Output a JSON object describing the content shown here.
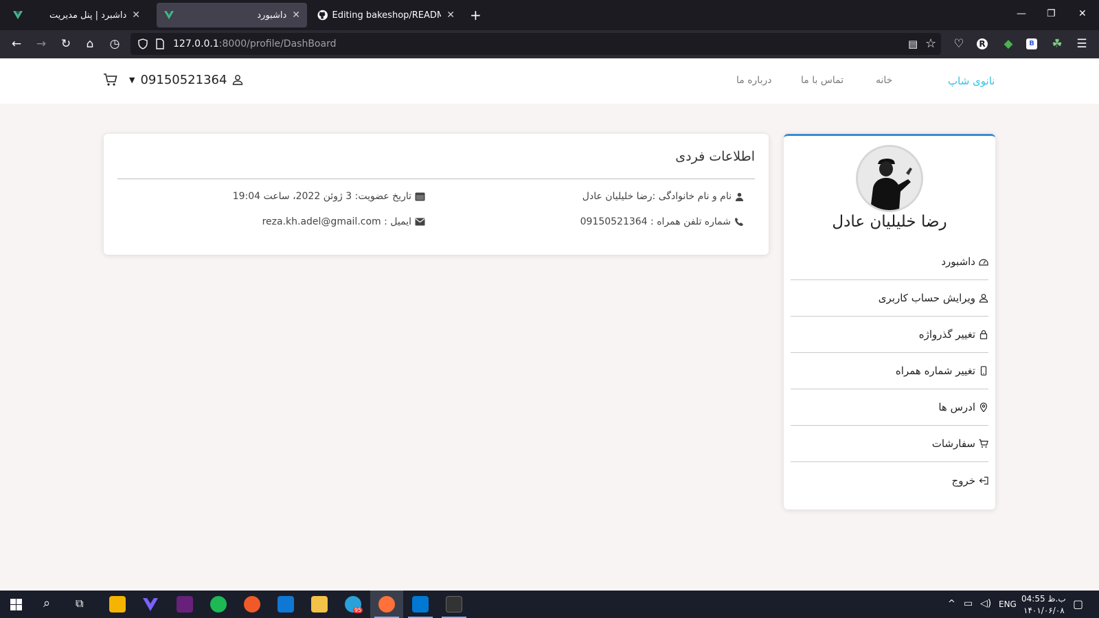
{
  "browser": {
    "tabs": [
      {
        "title": "داشبرد | پنل مدیریت"
      },
      {
        "title": "داشبورد"
      },
      {
        "title": "Editing bakeshop/README.md"
      }
    ],
    "url_host": "127.0.0.1",
    "url_rest": ":8000/profile/DashBoard"
  },
  "header": {
    "brand": "نانوی شاپ",
    "nav": [
      "خانه",
      "تماس با ما",
      "درباره ما"
    ],
    "user_phone": "09150521364"
  },
  "info": {
    "title": "اطلاعات فردی",
    "name_field": "نام و نام خانوادگی :رضا خلیلیان عادل",
    "phone_field": "شماره تلفن همراه : 09150521364",
    "join_field": "تاریخ عضویت: 3 ژوئن 2022، ساعت 19:04",
    "email_field": "ایمیل : reza.kh.adel@gmail.com"
  },
  "profile": {
    "name": "رضا خلیلیان عادل",
    "menu": [
      {
        "label": "داشبورد",
        "icon": "dashboard-icon"
      },
      {
        "label": "ویرایش حساب کاربری",
        "icon": "user-icon"
      },
      {
        "label": "تغییر گذرواژه",
        "icon": "lock-icon"
      },
      {
        "label": "تغییر شماره همراه",
        "icon": "phone-icon"
      },
      {
        "label": "ادرس ها",
        "icon": "location-icon"
      },
      {
        "label": "سفارشات",
        "icon": "cart-icon"
      },
      {
        "label": "خروج",
        "icon": "logout-icon"
      }
    ]
  },
  "taskbar": {
    "lang": "ENG",
    "time": "04:55 ب.ظ",
    "date": "۱۴۰۱/۰۶/۰۸",
    "telegram_badge": "95"
  },
  "colors": {
    "brand": "#2ec4e0",
    "page_bg": "#f8f4f4",
    "profile_accent": "#3a8ad0"
  }
}
